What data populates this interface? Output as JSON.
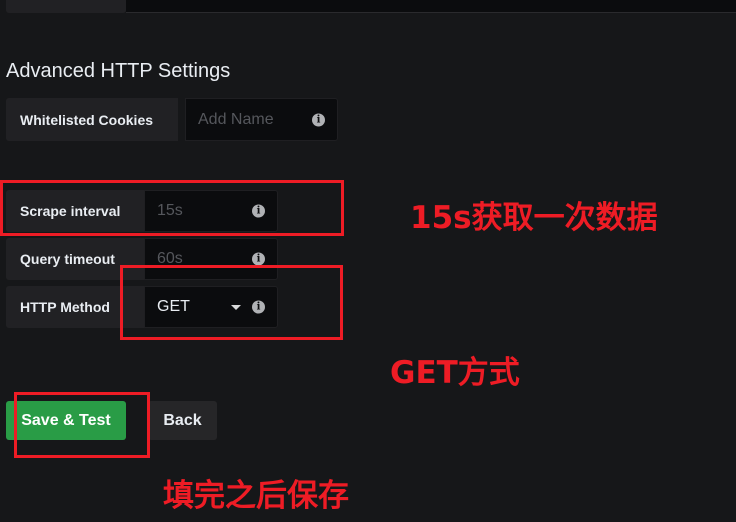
{
  "section_title": "Advanced HTTP Settings",
  "fields": {
    "whitelisted_cookies": {
      "label": "Whitelisted Cookies",
      "placeholder": "Add Name"
    },
    "scrape_interval": {
      "label": "Scrape interval",
      "placeholder": "15s"
    },
    "query_timeout": {
      "label": "Query timeout",
      "placeholder": "60s"
    },
    "http_method": {
      "label": "HTTP Method",
      "value": "GET"
    }
  },
  "buttons": {
    "save": "Save & Test",
    "back": "Back"
  },
  "annotations": {
    "scrape": "15s获取一次数据",
    "method": "GET方式",
    "save": "填完之后保存"
  },
  "icons": {
    "info": "info-circle-icon",
    "dropdown": "caret-down-icon"
  },
  "colors": {
    "accent_green": "#299c46",
    "annotation_red": "#ee1c25",
    "background": "#161719"
  }
}
